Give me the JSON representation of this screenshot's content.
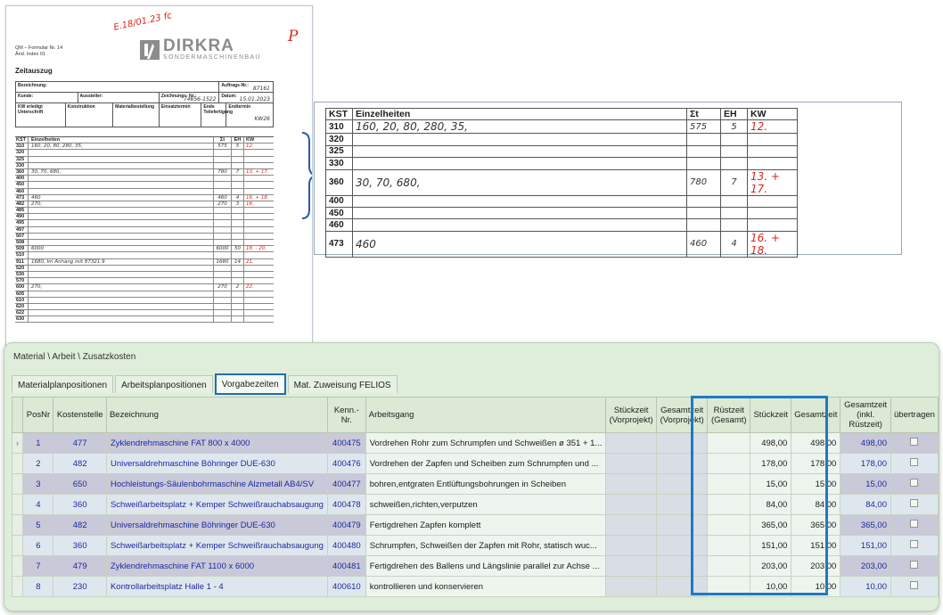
{
  "scan": {
    "note_top": "E.18/01.23 fc",
    "red_mark": "P",
    "logo": {
      "name": "DIRKRA",
      "sub": "SONDERMASCHINENBAU"
    },
    "meta": [
      "QM – Formular Nr. 14",
      "Änd. Index 01"
    ],
    "title": "Zeitauszug",
    "fields": {
      "bezeichnung": "Bezeichnung:",
      "auftrag": "Auftrags-Nr.:",
      "auftrag_val": "87161",
      "kunde": "Kunde:",
      "aussteller": "Aussteller:",
      "zeichnung": "Zeichnungs- Nr.:",
      "zeichnung_val": "74656-1522",
      "datum": "Datum:",
      "datum_val": "15.01.2023",
      "kw": "KW erledigt Unterschrift",
      "konstruktion": "Konstruktion",
      "material": "Materialbestellung",
      "einsatz": "Einsatztermin",
      "ende": "Ende Teilefertigung",
      "endtermin": "Endtermin",
      "kw26": "KW26"
    },
    "kst_head": {
      "k": "KST",
      "e": "Einzelheiten",
      "s": "Σt",
      "h": "EH",
      "w": "KW"
    },
    "kst_rows": [
      {
        "k": "310",
        "e": "160, 20, 80, 280, 35,",
        "s": "575",
        "h": "5",
        "w": "12."
      },
      {
        "k": "320",
        "e": "",
        "s": "",
        "h": "",
        "w": ""
      },
      {
        "k": "325",
        "e": "",
        "s": "",
        "h": "",
        "w": ""
      },
      {
        "k": "330",
        "e": "",
        "s": "",
        "h": "",
        "w": ""
      },
      {
        "k": "360",
        "e": "30, 70, 680,",
        "s": "780",
        "h": "7",
        "w": "13. + 17."
      },
      {
        "k": "400",
        "e": "",
        "s": "",
        "h": "",
        "w": ""
      },
      {
        "k": "450",
        "e": "",
        "s": "",
        "h": "",
        "w": ""
      },
      {
        "k": "460",
        "e": "",
        "s": "",
        "h": "",
        "w": ""
      },
      {
        "k": "473",
        "e": "460",
        "s": "460",
        "h": "4",
        "w": "16. + 18."
      },
      {
        "k": "482",
        "e": "270,",
        "s": "270",
        "h": "3",
        "w": "16."
      },
      {
        "k": "485",
        "e": "",
        "s": "",
        "h": "",
        "w": ""
      },
      {
        "k": "490",
        "e": "",
        "s": "",
        "h": "",
        "w": ""
      },
      {
        "k": "495",
        "e": "",
        "s": "",
        "h": "",
        "w": ""
      },
      {
        "k": "497",
        "e": "",
        "s": "",
        "h": "",
        "w": ""
      },
      {
        "k": "507",
        "e": "",
        "s": "",
        "h": "",
        "w": ""
      },
      {
        "k": "508",
        "e": "",
        "s": "",
        "h": "",
        "w": ""
      },
      {
        "k": "509",
        "e": "6000",
        "s": "6000",
        "h": "50",
        "w": "18. - 20."
      },
      {
        "k": "510",
        "e": "",
        "s": "",
        "h": "",
        "w": ""
      },
      {
        "k": "911",
        "e": "1680,    Im Anhang mit 87321.9",
        "s": "1680",
        "h": "14",
        "w": "21."
      },
      {
        "k": "520",
        "e": "",
        "s": "",
        "h": "",
        "w": ""
      },
      {
        "k": "530",
        "e": "",
        "s": "",
        "h": "",
        "w": ""
      },
      {
        "k": "570",
        "e": "",
        "s": "",
        "h": "",
        "w": ""
      },
      {
        "k": "600",
        "e": "270,",
        "s": "270",
        "h": "2",
        "w": "22."
      },
      {
        "k": "605",
        "e": "",
        "s": "",
        "h": "",
        "w": ""
      },
      {
        "k": "610",
        "e": "",
        "s": "",
        "h": "",
        "w": ""
      },
      {
        "k": "620",
        "e": "",
        "s": "",
        "h": "",
        "w": ""
      },
      {
        "k": "622",
        "e": "",
        "s": "",
        "h": "",
        "w": ""
      },
      {
        "k": "630",
        "e": "",
        "s": "",
        "h": "",
        "w": ""
      }
    ]
  },
  "zoom": {
    "head": {
      "k": "KST",
      "e": "Einzelheiten",
      "s": "Σt",
      "h": "EH",
      "w": "KW"
    },
    "rows": [
      {
        "k": "310",
        "e": "160, 20, 80, 280, 35,",
        "s": "575",
        "h": "5",
        "w": "12."
      },
      {
        "k": "320",
        "e": "",
        "s": "",
        "h": "",
        "w": ""
      },
      {
        "k": "325",
        "e": "",
        "s": "",
        "h": "",
        "w": ""
      },
      {
        "k": "330",
        "e": "",
        "s": "",
        "h": "",
        "w": ""
      },
      {
        "k": "360",
        "e": "30, 70, 680,",
        "s": "780",
        "h": "7",
        "w": "13. + 17."
      },
      {
        "k": "400",
        "e": "",
        "s": "",
        "h": "",
        "w": ""
      },
      {
        "k": "450",
        "e": "",
        "s": "",
        "h": "",
        "w": ""
      },
      {
        "k": "460",
        "e": "",
        "s": "",
        "h": "",
        "w": ""
      },
      {
        "k": "473",
        "e": "460",
        "s": "460",
        "h": "4",
        "w": "16. + 18."
      }
    ]
  },
  "erp": {
    "window_title": "Material \\ Arbeit \\ Zusatzkosten",
    "tabs": [
      "Materialplanpositionen",
      "Arbeitsplanpositionen",
      "Vorgabezeiten",
      "Mat. Zuweisung FELIOS"
    ],
    "active_tab": 2,
    "columns": [
      "PosNr",
      "Kostenstelle",
      "Bezeichnung",
      "Kenn.-Nr.",
      "Arbeitsgang",
      "Stückzeit (Vorprojekt)",
      "Gesamtzeit (Vorprojekt)",
      "Rüstzeit (Gesamt)",
      "Stückzeit",
      "Gesamtzeit",
      "Gesamtzeit (inkl. Rüstzeit)",
      "übertragen"
    ],
    "rows": [
      {
        "pos": "1",
        "kst": "477",
        "bez": "Zyklendrehmaschine FAT 800 x 4000",
        "kenn": "400475",
        "ag": "Vordrehen Rohr zum Schrumpfen und Schweißen ø 351 + 1...",
        "st": "498,00",
        "gz": "498,00",
        "gzr": "498,00"
      },
      {
        "pos": "2",
        "kst": "482",
        "bez": "Universaldrehmaschine Böhringer DUE-630",
        "kenn": "400476",
        "ag": "Vordrehen der Zapfen und Scheiben zum Schrumpfen und ...",
        "st": "178,00",
        "gz": "178,00",
        "gzr": "178,00"
      },
      {
        "pos": "3",
        "kst": "650",
        "bez": "Hochleistungs-Säulenbohrmaschine Alzmetall AB4/SV",
        "kenn": "400477",
        "ag": "bohren,entgraten Entlüftungsbohrungen in Scheiben",
        "st": "15,00",
        "gz": "15,00",
        "gzr": "15,00"
      },
      {
        "pos": "4",
        "kst": "360",
        "bez": "Schweißarbeitsplatz + Kemper Schweißrauchabsaugung",
        "kenn": "400478",
        "ag": "schweißen,richten,verputzen",
        "st": "84,00",
        "gz": "84,00",
        "gzr": "84,00"
      },
      {
        "pos": "5",
        "kst": "482",
        "bez": "Universaldrehmaschine Böhringer DUE-630",
        "kenn": "400479",
        "ag": "Fertigdrehen Zapfen komplett",
        "st": "365,00",
        "gz": "365,00",
        "gzr": "365,00"
      },
      {
        "pos": "6",
        "kst": "360",
        "bez": "Schweißarbeitsplatz + Kemper Schweißrauchabsaugung",
        "kenn": "400480",
        "ag": "Schrumpfen, Schweißen der Zapfen mit Rohr, statisch wuc...",
        "st": "151,00",
        "gz": "151,00",
        "gzr": "151,00"
      },
      {
        "pos": "7",
        "kst": "479",
        "bez": "Zyklendrehmaschine FAT 1100 x 6000",
        "kenn": "400481",
        "ag": "Fertigdrehen des Ballens und Längslinie parallel zur Achse ...",
        "st": "203,00",
        "gz": "203,00",
        "gzr": "203,00"
      },
      {
        "pos": "8",
        "kst": "230",
        "bez": "Kontrollarbeitsplatz Halle 1 - 4",
        "kenn": "400610",
        "ag": "kontrollieren und konservieren",
        "st": "10,00",
        "gz": "10,00",
        "gzr": "10,00"
      }
    ],
    "row_indicator": "›"
  },
  "colors": {
    "accent": "#1e6db8",
    "red_ink": "#d9261c",
    "link_blue": "#1c2a9e"
  }
}
